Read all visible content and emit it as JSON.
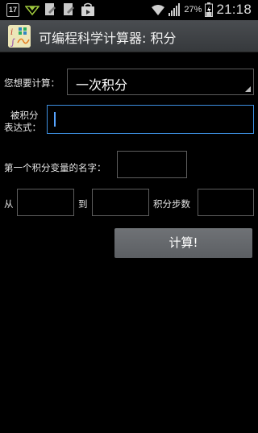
{
  "status_bar": {
    "calendar_day": "17",
    "battery_percent": "27%",
    "time": "21:18"
  },
  "app": {
    "title": "可编程科学计算器: 积分"
  },
  "form": {
    "compute_label": "您想要计算：",
    "compute_selected": "一次积分",
    "integrand_label_line1": "被积分",
    "integrand_label_line2": "表达式：",
    "integrand_value": "",
    "variable_label": "第一个积分变量的名字：",
    "variable_value": "",
    "from_label": "从",
    "from_value": "",
    "to_label": "到",
    "to_value": "",
    "steps_label": "积分步数",
    "steps_value": "",
    "compute_button": "计算!"
  },
  "colors": {
    "background": "#000000",
    "title_bar": "#404346",
    "focus_border": "#3d8fe0",
    "button": "#66696d"
  }
}
